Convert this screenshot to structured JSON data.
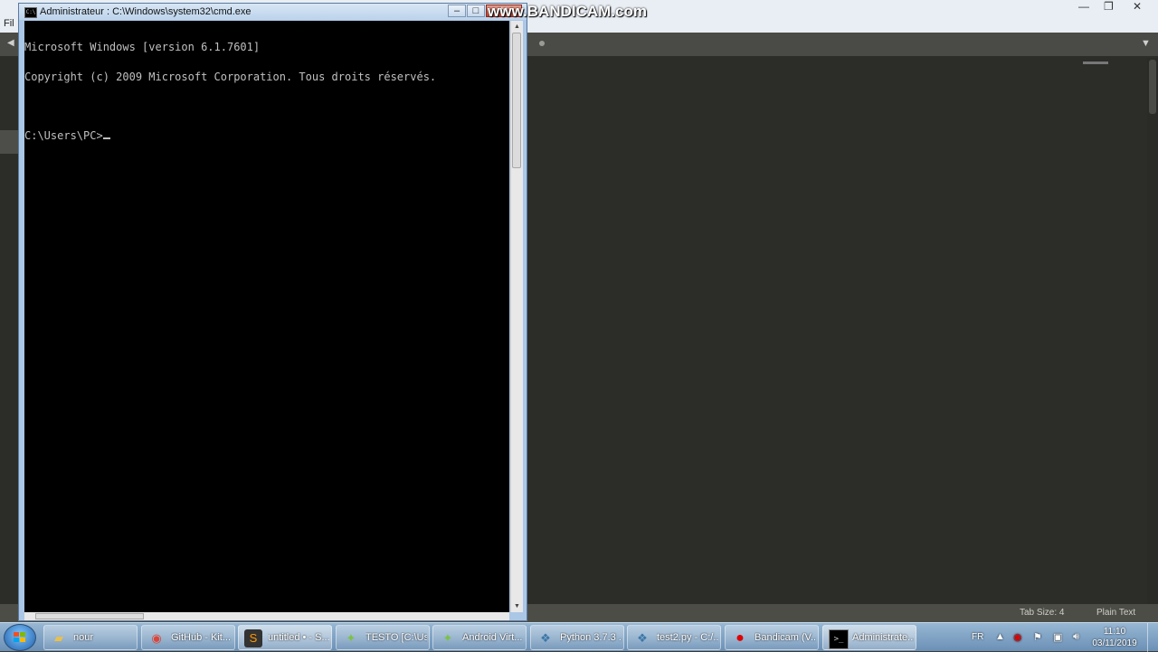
{
  "editor": {
    "menu_file": "Fil",
    "status_tab_size": "Tab Size: 4",
    "status_syntax": "Plain Text"
  },
  "cmd": {
    "title": "Administrateur : C:\\Windows\\system32\\cmd.exe",
    "lines": [
      "Microsoft Windows [version 6.1.7601]",
      "Copyright (c) 2009 Microsoft Corporation. Tous droits réservés."
    ],
    "prompt": "C:\\Users\\PC>"
  },
  "watermark": "www.BANDICAM.com",
  "taskbar": {
    "items": [
      {
        "label": "nour",
        "icon": "folder-icon"
      },
      {
        "label": "GitHub - Kit...",
        "icon": "chrome-icon"
      },
      {
        "label": "untitled • - S...",
        "icon": "sublime-text-icon"
      },
      {
        "label": "TESTO [C:\\Us...",
        "icon": "android-studio-icon"
      },
      {
        "label": "Android Virt...",
        "icon": "android-studio-icon"
      },
      {
        "label": "Python 3.7.3 ...",
        "icon": "python-icon"
      },
      {
        "label": "test2.py - C:/...",
        "icon": "python-file-icon"
      },
      {
        "label": "Bandicam (V...",
        "icon": "record-icon"
      },
      {
        "label": "Administrate...",
        "icon": "cmd-icon"
      }
    ],
    "tray_language": "FR",
    "clock_time": "11:10",
    "clock_date": "03/11/2019"
  }
}
